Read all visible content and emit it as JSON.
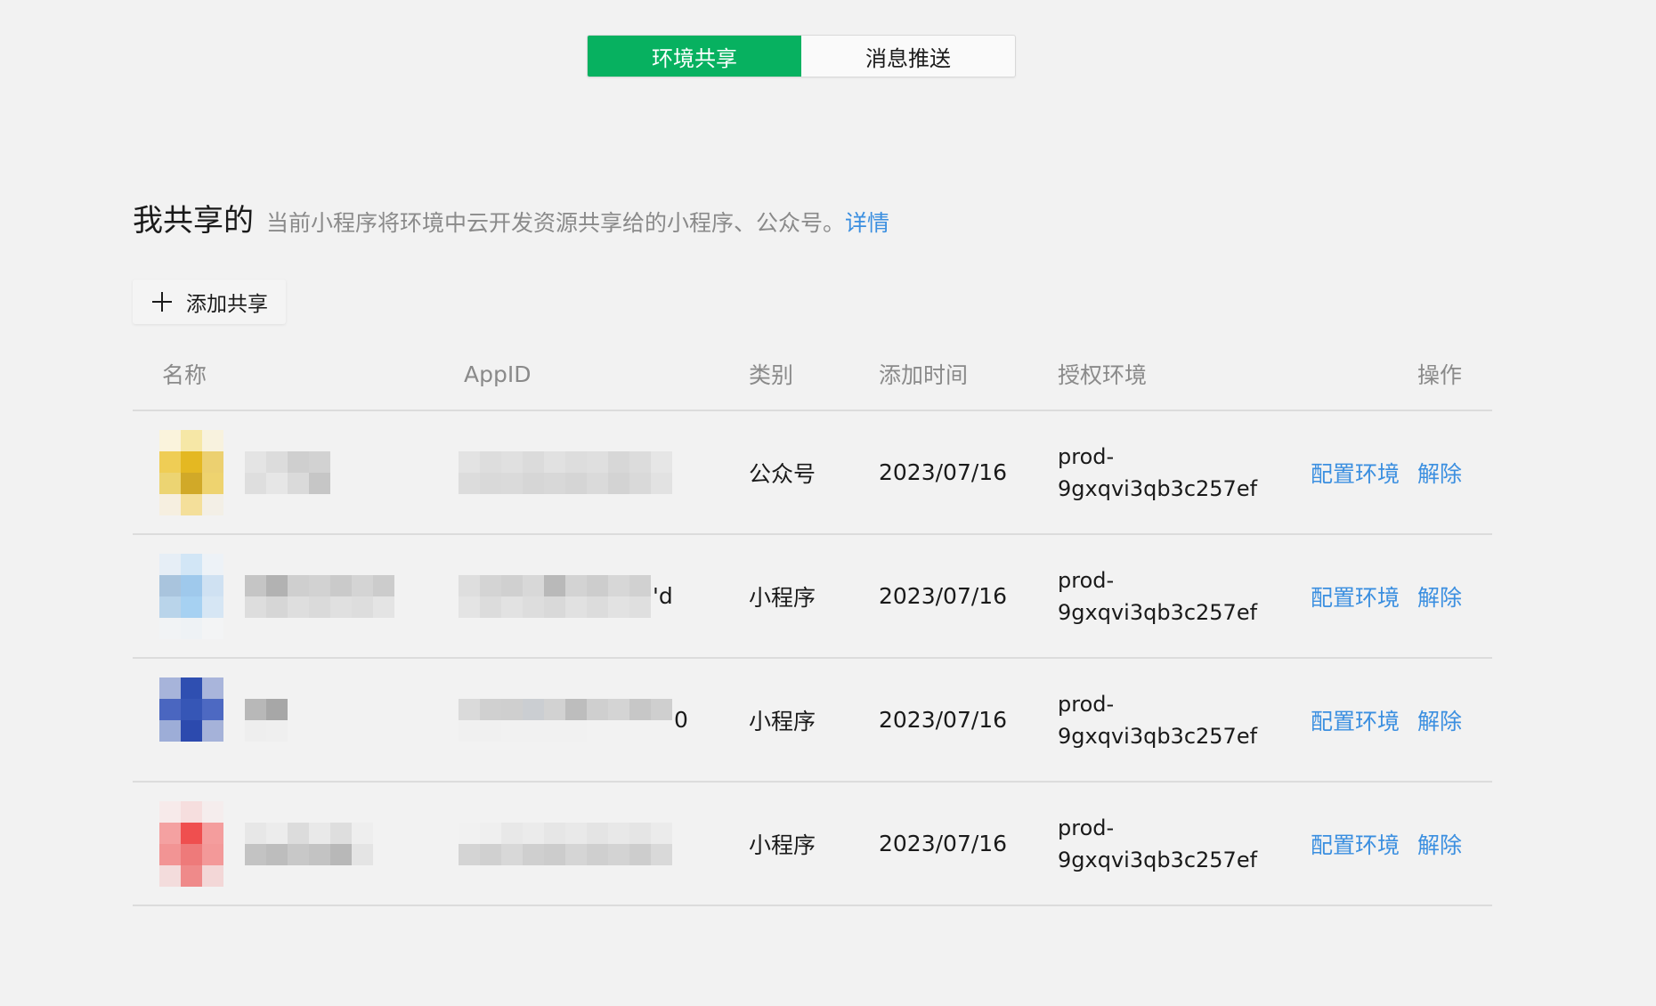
{
  "tabs": [
    {
      "label": "环境共享",
      "active": true
    },
    {
      "label": "消息推送",
      "active": false
    }
  ],
  "section": {
    "title": "我共享的",
    "description": "当前小程序将环境中云开发资源共享给的小程序、公众号。",
    "detail_link": "详情"
  },
  "add_button": {
    "label": "添加共享",
    "icon": "plus-icon"
  },
  "table": {
    "headers": {
      "name": "名称",
      "appid": "AppID",
      "type": "类别",
      "added_time": "添加时间",
      "auth_env": "授权环境",
      "actions": "操作"
    },
    "rows": [
      {
        "appid_suffix": "",
        "type": "公众号",
        "added_time": "2023/07/16",
        "env_line1": "prod-",
        "env_line2": "9gxqvi3qb3c257ef",
        "config_label": "配置环境",
        "remove_label": "解除"
      },
      {
        "appid_suffix": "'d",
        "type": "小程序",
        "added_time": "2023/07/16",
        "env_line1": "prod-",
        "env_line2": "9gxqvi3qb3c257ef",
        "config_label": "配置环境",
        "remove_label": "解除"
      },
      {
        "appid_suffix": "0",
        "type": "小程序",
        "added_time": "2023/07/16",
        "env_line1": "prod-",
        "env_line2": "9gxqvi3qb3c257ef",
        "config_label": "配置环境",
        "remove_label": "解除"
      },
      {
        "appid_suffix": "",
        "type": "小程序",
        "added_time": "2023/07/16",
        "env_line1": "prod-",
        "env_line2": "9gxqvi3qb3c257ef",
        "config_label": "配置环境",
        "remove_label": "解除"
      }
    ]
  },
  "colors": {
    "accent_green": "#07b160",
    "link_blue": "#3b8fe0",
    "background": "#f2f2f2",
    "muted_text": "#8a8a8a"
  }
}
